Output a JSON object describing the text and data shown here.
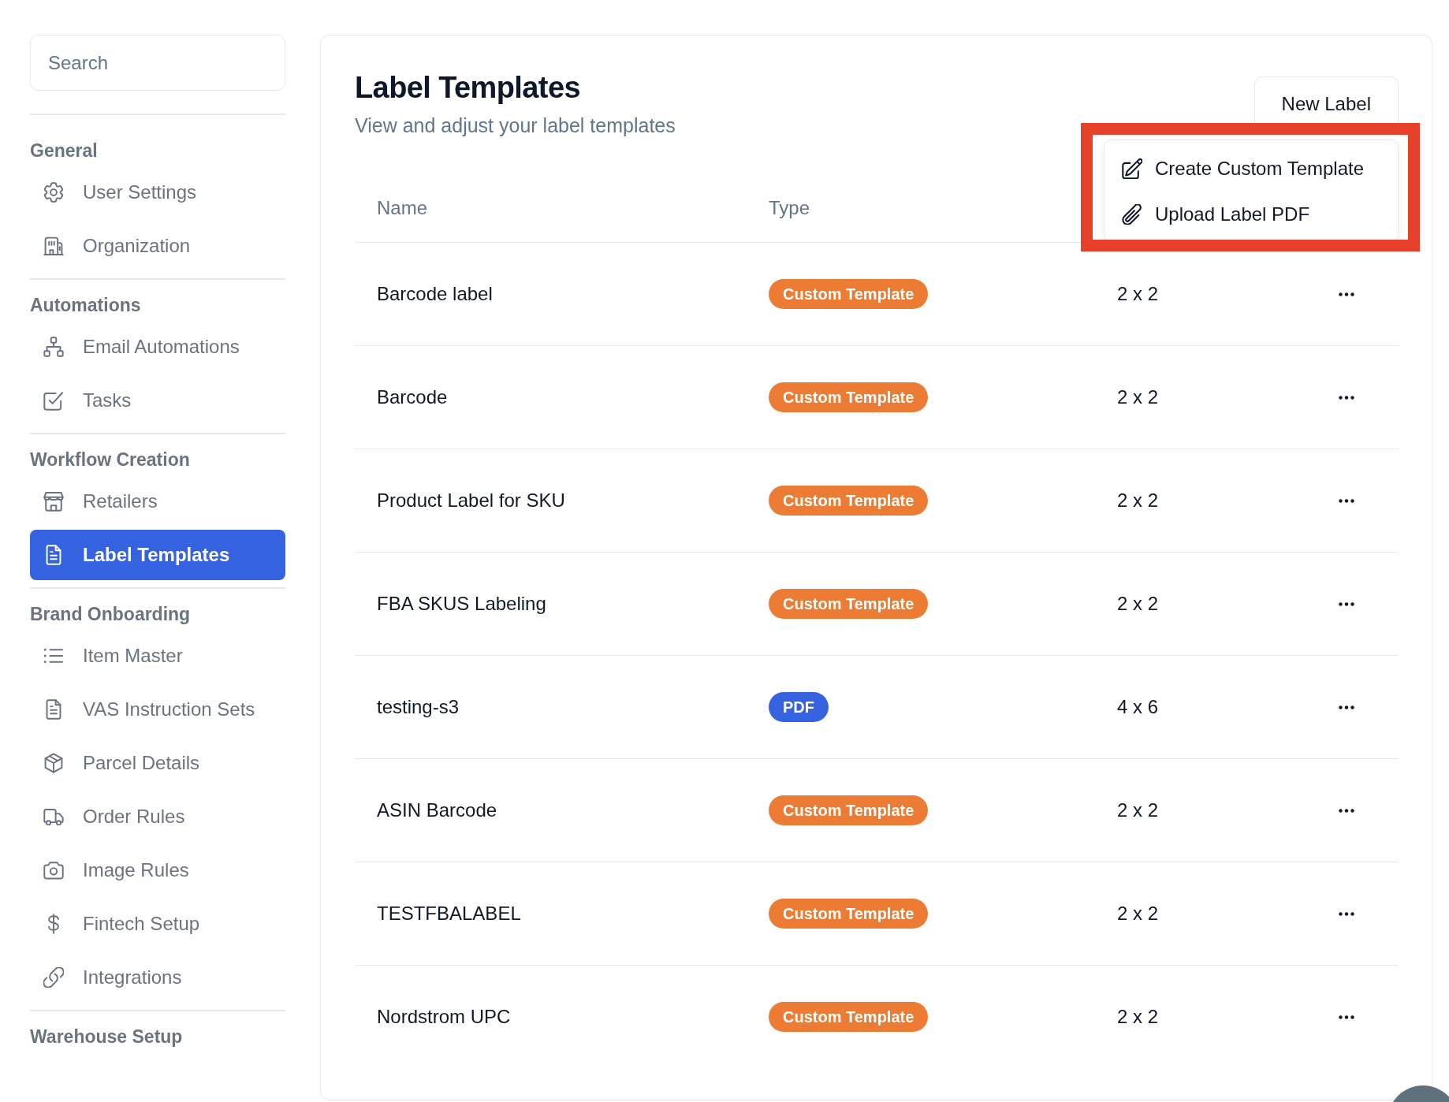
{
  "sidebar": {
    "search": {
      "placeholder": "Search"
    },
    "sections": [
      {
        "title": "General",
        "items": [
          {
            "label": "User Settings",
            "selected": false
          },
          {
            "label": "Organization",
            "selected": false
          }
        ]
      },
      {
        "title": "Automations",
        "items": [
          {
            "label": "Email Automations",
            "selected": false
          },
          {
            "label": "Tasks",
            "selected": false
          }
        ]
      },
      {
        "title": "Workflow Creation",
        "items": [
          {
            "label": "Retailers",
            "selected": false
          },
          {
            "label": "Label Templates",
            "selected": true
          }
        ]
      },
      {
        "title": "Brand Onboarding",
        "items": [
          {
            "label": "Item Master",
            "selected": false
          },
          {
            "label": "VAS Instruction Sets",
            "selected": false
          },
          {
            "label": "Parcel Details",
            "selected": false
          },
          {
            "label": "Order Rules",
            "selected": false
          },
          {
            "label": "Image Rules",
            "selected": false
          },
          {
            "label": "Fintech Setup",
            "selected": false
          },
          {
            "label": "Integrations",
            "selected": false
          }
        ]
      },
      {
        "title": "Warehouse Setup"
      }
    ]
  },
  "header": {
    "title": "Label Templates",
    "subtitle": "View and adjust your label templates",
    "new_button": "New Label"
  },
  "dropdown": {
    "highlighted": true,
    "items": [
      {
        "label": "Create Custom Template"
      },
      {
        "label": "Upload Label PDF"
      }
    ]
  },
  "table": {
    "columns": [
      "Name",
      "Type"
    ],
    "rows": [
      {
        "name": "Barcode label",
        "type": {
          "label": "Custom Template",
          "color": "#ec7c33"
        },
        "column_3": "2 x 2"
      },
      {
        "name": "Barcode",
        "type": {
          "label": "Custom Template",
          "color": "#ec7c33"
        },
        "column_3": "2 x 2"
      },
      {
        "name": "Product Label for SKU",
        "type": {
          "label": "Custom Template",
          "color": "#ec7c33"
        },
        "column_3": "2 x 2"
      },
      {
        "name": "FBA SKUS Labeling",
        "type": {
          "label": "Custom Template",
          "color": "#ec7c33"
        },
        "column_3": "2 x 2"
      },
      {
        "name": "testing-s3",
        "type": {
          "label": "PDF",
          "color": "#3563e0"
        },
        "column_3": "4 x 6"
      },
      {
        "name": "ASIN Barcode",
        "type": {
          "label": "Custom Template",
          "color": "#ec7c33"
        },
        "column_3": "2 x 2"
      },
      {
        "name": "TESTFBALABEL",
        "type": {
          "label": "Custom Template",
          "color": "#ec7c33"
        },
        "column_3": "2 x 2"
      },
      {
        "name": "Nordstrom UPC",
        "type": {
          "label": "Custom Template",
          "color": "#ec7c33"
        },
        "column_3": "2 x 2"
      }
    ]
  }
}
